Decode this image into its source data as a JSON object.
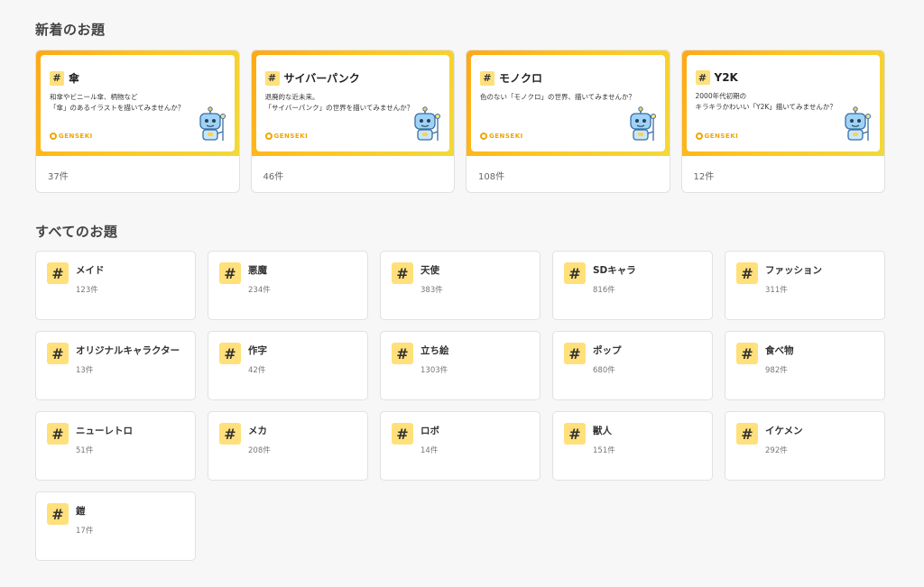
{
  "sections": {
    "new_title": "新着のお題",
    "all_title": "すべてのお題"
  },
  "hash_symbol": "#",
  "logo_text": "GENSEKI",
  "featured": [
    {
      "title": "傘",
      "desc": "和傘やビニール傘、柄物など\n「傘」のあるイラストを描いてみませんか？",
      "count": "37件"
    },
    {
      "title": "サイバーパンク",
      "desc": "退廃的な近未来。\n「サイバーパンク」の世界を描いてみませんか？",
      "count": "46件"
    },
    {
      "title": "モノクロ",
      "desc": "色のない「モノクロ」の世界、描いてみませんか？",
      "count": "108件"
    },
    {
      "title": "Y2K",
      "desc": "2000年代初期の\nキラキラかわいい「Y2K」描いてみませんか？",
      "count": "12件"
    }
  ],
  "topics": [
    {
      "name": "メイド",
      "count": "123件"
    },
    {
      "name": "悪魔",
      "count": "234件"
    },
    {
      "name": "天使",
      "count": "383件"
    },
    {
      "name": "SDキャラ",
      "count": "816件"
    },
    {
      "name": "ファッション",
      "count": "311件"
    },
    {
      "name": "オリジナルキャラクター",
      "count": "13件"
    },
    {
      "name": "作字",
      "count": "42件"
    },
    {
      "name": "立ち絵",
      "count": "1303件"
    },
    {
      "name": "ポップ",
      "count": "680件"
    },
    {
      "name": "食べ物",
      "count": "982件"
    },
    {
      "name": "ニューレトロ",
      "count": "51件"
    },
    {
      "name": "メカ",
      "count": "208件"
    },
    {
      "name": "ロボ",
      "count": "14件"
    },
    {
      "name": "獣人",
      "count": "151件"
    },
    {
      "name": "イケメン",
      "count": "292件"
    },
    {
      "name": "鎧",
      "count": "17件"
    }
  ],
  "colors": {
    "accent": "#ffc51f",
    "hash_bg": "#ffe07a",
    "logo": "#f0a500",
    "background": "#f7f7f7"
  },
  "icons": {
    "featured_mascot": "robot-mascot-icon",
    "logo_mark": "genseki-logo-icon",
    "topic_tag": "hashtag-icon"
  }
}
